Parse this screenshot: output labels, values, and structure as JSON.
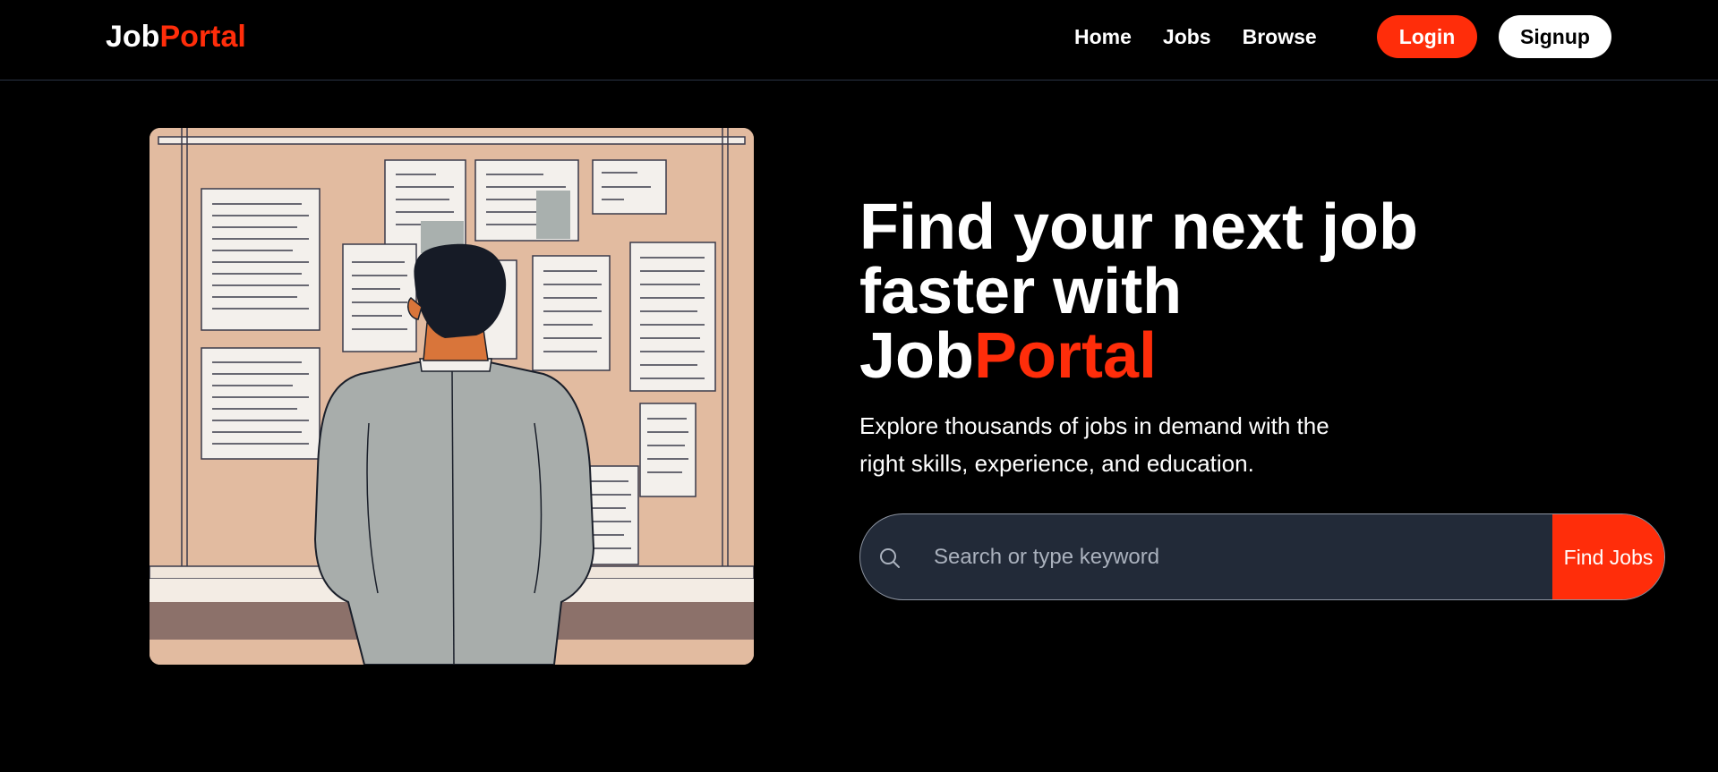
{
  "nav": {
    "logo_part1": "Job",
    "logo_part2": "Portal",
    "links": [
      "Home",
      "Jobs",
      "Browse"
    ],
    "login_label": "Login",
    "signup_label": "Signup"
  },
  "hero": {
    "title_line1": "Find your next job",
    "title_line2": "faster with",
    "title_brand_part1": "Job",
    "title_brand_part2": "Portal",
    "subtitle_line1": "Explore thousands of jobs in demand with the",
    "subtitle_line2": "right skills, experience, and education."
  },
  "search": {
    "placeholder": "Search or type keyword",
    "button_label": "Find Jobs",
    "icon": "search-icon"
  },
  "colors": {
    "accent": "#ff2d0a",
    "background": "#000000",
    "search_bg": "#222a38"
  }
}
